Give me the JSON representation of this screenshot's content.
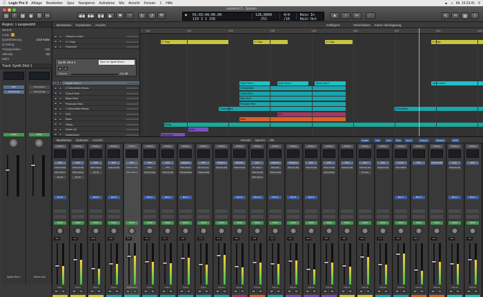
{
  "menubar": {
    "app_name": "Logic Pro X",
    "items": [
      "Ablage",
      "Bearbeiten",
      "Spur",
      "Navigieren",
      "Aufnahme",
      "Mix",
      "Ansicht",
      "Fenster",
      "1",
      "Hilfe"
    ],
    "time": "Mi. 15:23:41"
  },
  "window": {
    "title": "neoninst 3 - Spuren"
  },
  "lcd": {
    "position_smpte": "01:03:46:00.00",
    "position_bars": "119  3  1  156",
    "tempo": "128,0000",
    "tempo_sub": "251",
    "signature": "4/4",
    "division": "/16",
    "key_in": "Kein In",
    "key_out": "Kein Out"
  },
  "inspector": {
    "region_header": "Region: 1 ausgewählt",
    "region_rows": [
      {
        "label": "Stumm",
        "value": ""
      },
      {
        "label": "Loop",
        "value": "check"
      },
      {
        "label": "Quantisierung",
        "value": "1/16 Note"
      },
      {
        "label": "Q-Swing",
        "value": ""
      },
      {
        "label": "Transposition",
        "value": "+12"
      },
      {
        "label": "Velocity",
        "value": "-22"
      },
      {
        "label": "Mehr",
        "value": ""
      }
    ],
    "track_header": "Track: Synth Shot 1",
    "strip_names": [
      "Synth Shot 1",
      "Stereo Out"
    ]
  },
  "tracks_toolbar": [
    "Bearbeiten",
    "Funktionen",
    "Ansicht",
    "Intelligent",
    "Verschieben",
    "Keine Überlappung"
  ],
  "synth_popup": {
    "title": "Synth Shot 1",
    "field": "Spur 11 Synth Shot 1",
    "volume_label": "Volume",
    "volume_value": "-0,0 dB"
  },
  "tracks": [
    "Unisono Leiter",
    "1+ Clap",
    "Snareroll",
    "",
    "",
    "",
    "",
    "",
    "",
    "Synth Shot 1",
    "2 Schneiden Brass",
    "Chord Shot",
    "Bass Shot",
    "Pizzicato Shot",
    "1 Schneiden Brass",
    "SFX",
    "Bass",
    "String",
    "Noise Up",
    "Noisedown"
  ],
  "ruler": [
    "113",
    "117",
    "121",
    "125",
    "129",
    "133",
    "137",
    "141",
    "145"
  ],
  "regions": [
    {
      "label": "1+ Clap",
      "color": "#c8c63a",
      "row": 1,
      "start": 0.06,
      "end": 0.26
    },
    {
      "label": "1+ Clap",
      "color": "#c8c63a",
      "row": 1,
      "start": 0.33,
      "end": 0.43
    },
    {
      "label": "1+ Clap",
      "color": "#c8c63a",
      "row": 1,
      "start": 0.54,
      "end": 0.62
    },
    {
      "label": "1+ Clap",
      "color": "#c8c63a",
      "row": 1,
      "start": 0.85,
      "end": 1.0
    },
    {
      "label": "Synth Shot 1",
      "color": "#1fc0c8",
      "row": 9,
      "start": 0.29,
      "end": 0.38
    },
    {
      "label": "Synth Shot 1",
      "color": "#1fc0c8",
      "row": 9,
      "start": 0.4,
      "end": 0.49
    },
    {
      "label": "Synth Shot 1",
      "color": "#1fc0c8",
      "row": 9,
      "start": 0.51,
      "end": 0.6
    },
    {
      "label": "2 Schneiden",
      "color": "#1aa5ad",
      "row": 10,
      "start": 0.29,
      "end": 0.6
    },
    {
      "label": "Chord Shot",
      "color": "#1aa5ad",
      "row": 11,
      "start": 0.29,
      "end": 0.6
    },
    {
      "label": "Bass Shot",
      "color": "#1aa5ad",
      "row": 12,
      "start": 0.29,
      "end": 0.6
    },
    {
      "label": "Pizzicato Shot",
      "color": "#1aa5ad",
      "row": 13,
      "start": 0.29,
      "end": 0.6
    },
    {
      "label": "1 Schneiden",
      "color": "#1aa5ad",
      "row": 14,
      "start": 0.23,
      "end": 0.6
    },
    {
      "label": "SFX",
      "color": "#a8375f",
      "row": 15,
      "start": 0.4,
      "end": 0.6
    },
    {
      "label": "Bass",
      "color": "#d9622a",
      "row": 16,
      "start": 0.29,
      "end": 0.6
    },
    {
      "label": "String",
      "color": "#19a89b",
      "row": 17,
      "start": 0.07,
      "end": 1.0
    },
    {
      "label": "Noise",
      "color": "#7a4fbd",
      "row": 18,
      "start": 0.14,
      "end": 0.2
    },
    {
      "label": "Noisedown",
      "color": "#7a4fbd",
      "row": 19,
      "start": 0.06,
      "end": 0.13
    },
    {
      "label": "1 Schneiden",
      "color": "#1aa5ad",
      "row": 14,
      "start": 0.74,
      "end": 1.0
    },
    {
      "label": "Synth Shot 1",
      "color": "#1fc0c8",
      "row": 9,
      "start": 0.85,
      "end": 1.0
    }
  ],
  "mixer_toolbar": {
    "items": [
      "Bearbeiten",
      "Optionen",
      "Ansicht",
      "Einzeln",
      "Spuren",
      "Alle"
    ],
    "filters": [
      "Audio",
      "Inst",
      "Aux",
      "Bus",
      "Input",
      "Output",
      "Master",
      "MIDI"
    ]
  },
  "strips": [
    {
      "name": "Inst 1",
      "slots": [
        "ES2",
        "Channel EQ",
        "VPG Stereo",
        "ES 20"
      ],
      "send": "Bus 8",
      "db": "-8,2",
      "fader": 0.55,
      "color": "#c8c63a"
    },
    {
      "name": "Inst 2",
      "slots": [
        "ES2",
        "Channel EQ",
        "VPG Stereo",
        "ES 20"
      ],
      "send": "",
      "db": "-3,1",
      "fader": 0.4,
      "color": "#c8c63a"
    },
    {
      "name": "Inst 3",
      "slots": [
        "ES2",
        "VPG Stereo",
        "ES 20"
      ],
      "send": "Bus 8",
      "db": "-10,5",
      "fader": 0.62,
      "color": "#c8c63a"
    },
    {
      "name": "Inst 4",
      "slots": [
        "ES2",
        "Channel EQ"
      ],
      "send": "Bus 8",
      "db": "-6,0",
      "fader": 0.5,
      "color": "#1aa5ad"
    },
    {
      "name": "Synth Shot",
      "slots": [
        "ES2",
        "Channel EQ",
        "VPG Stereo"
      ],
      "send": "",
      "db": "0,0",
      "fader": 0.3,
      "color": "#1fc0c8"
    },
    {
      "name": "Inst 6",
      "slots": [
        "ES2",
        "MOD",
        "Channel EQ"
      ],
      "send": "Bus 4",
      "db": "-4,2",
      "fader": 0.45,
      "color": "#1aa5ad"
    },
    {
      "name": "Inst 7",
      "slots": [
        "ES2",
        "VPG",
        "Channel EQ"
      ],
      "send": "Bus 4",
      "db": "-5,7",
      "fader": 0.48,
      "color": "#1aa5ad"
    },
    {
      "name": "Inst 8",
      "slots": [
        "Massive",
        "VPG Player",
        "VPG Exploder"
      ],
      "send": "Bus 4",
      "db": "-2,5",
      "fader": 0.35,
      "color": "#1aa5ad"
    },
    {
      "name": "Inst 9",
      "slots": [
        "ES2",
        "PF Thrones",
        "Channel EQ"
      ],
      "send": "",
      "db": "-7,9",
      "fader": 0.52,
      "color": "#1aa5ad"
    },
    {
      "name": "Inst 10",
      "slots": [
        "Massive",
        "Channel EQ"
      ],
      "send": "",
      "db": "-1,2",
      "fader": 0.28,
      "color": "#1aa5ad"
    },
    {
      "name": "Inst 11",
      "slots": [
        "Electrik",
        "Channel EQ"
      ],
      "send": "Bus 8",
      "db": "-9,0",
      "fader": 0.58,
      "color": "#a8375f"
    },
    {
      "name": "Inst 12",
      "slots": [
        "ES2",
        "PF Saturn",
        "Channel EQ",
        "VPG Stereo"
      ],
      "send": "Bus 14",
      "db": "-4,8",
      "fader": 0.46,
      "color": "#d9622a"
    },
    {
      "name": "Inst 13",
      "slots": [
        "Massive",
        "Shredder",
        "Channel EQ"
      ],
      "send": "Bus 8",
      "db": "-6,4",
      "fader": 0.5,
      "color": "#19a89b"
    },
    {
      "name": "Inst 14",
      "slots": [
        "Massive",
        "Channel EQ"
      ],
      "send": "Bus 8",
      "db": "-3,7",
      "fader": 0.42,
      "color": "#7a4fbd"
    },
    {
      "name": "Inst 15",
      "slots": [
        "ES2",
        "Channel EQ"
      ],
      "send": "Bus 8",
      "db": "-11,2",
      "fader": 0.64,
      "color": "#7a4fbd"
    },
    {
      "name": "Inst 16",
      "slots": [
        "ES2",
        "Channel EQ",
        "Compressor"
      ],
      "send": "",
      "db": "-5,0",
      "fader": 0.47,
      "color": "#7a4fbd"
    },
    {
      "name": "Inst 17",
      "slots": [
        "ES2",
        "Channel EQ"
      ],
      "send": "",
      "db": "-8,8",
      "fader": 0.56,
      "color": "#c8c63a"
    },
    {
      "name": "Inst 18",
      "slots": [
        "ES2",
        "Channel EQ",
        "Tremolo"
      ],
      "send": "",
      "db": "-2,0",
      "fader": 0.33,
      "color": "#c8c63a"
    },
    {
      "name": "Inst 19",
      "slots": [
        "ES2",
        "Channel EQ"
      ],
      "send": "",
      "db": "-7,1",
      "fader": 0.51,
      "color": "#1aa5ad"
    },
    {
      "name": "Inst 20",
      "slots": [
        "Limiter",
        "VPG Drifter"
      ],
      "send": "Bus 4",
      "db": "-0,6",
      "fader": 0.25,
      "color": "#1aa5ad"
    },
    {
      "name": "Inst 21",
      "slots": [
        "ES2"
      ],
      "send": "Bus 4",
      "db": "-12,0",
      "fader": 0.66,
      "color": "#d9622a"
    },
    {
      "name": "Inst 22",
      "slots": [
        "Channel EQ"
      ],
      "send": "",
      "db": "-4,4",
      "fader": 0.45,
      "color": "#d9622a"
    },
    {
      "name": "Inst 23",
      "slots": [
        "ES2",
        "Channel EQ"
      ],
      "send": "Bus 4",
      "db": "-6,9",
      "fader": 0.5,
      "color": "#1fc0c8"
    },
    {
      "name": "Inst 24",
      "slots": [
        "ES2"
      ],
      "send": "Bus 4",
      "db": "-3,3",
      "fader": 0.4,
      "color": "#1fc0c8"
    }
  ],
  "strip_labels": {
    "setting": "Setting",
    "read": "Read",
    "mute": "M",
    "solo": "S"
  }
}
